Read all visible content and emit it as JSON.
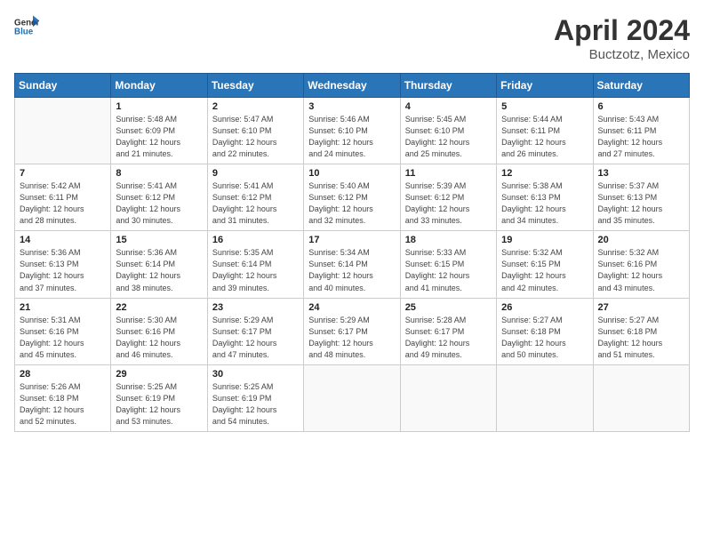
{
  "header": {
    "logo": {
      "general": "General",
      "blue": "Blue"
    },
    "title": "April 2024",
    "location": "Buctzotz, Mexico"
  },
  "calendar": {
    "weekdays": [
      "Sunday",
      "Monday",
      "Tuesday",
      "Wednesday",
      "Thursday",
      "Friday",
      "Saturday"
    ],
    "weeks": [
      [
        {
          "day": "",
          "info": ""
        },
        {
          "day": "1",
          "info": "Sunrise: 5:48 AM\nSunset: 6:09 PM\nDaylight: 12 hours\nand 21 minutes."
        },
        {
          "day": "2",
          "info": "Sunrise: 5:47 AM\nSunset: 6:10 PM\nDaylight: 12 hours\nand 22 minutes."
        },
        {
          "day": "3",
          "info": "Sunrise: 5:46 AM\nSunset: 6:10 PM\nDaylight: 12 hours\nand 24 minutes."
        },
        {
          "day": "4",
          "info": "Sunrise: 5:45 AM\nSunset: 6:10 PM\nDaylight: 12 hours\nand 25 minutes."
        },
        {
          "day": "5",
          "info": "Sunrise: 5:44 AM\nSunset: 6:11 PM\nDaylight: 12 hours\nand 26 minutes."
        },
        {
          "day": "6",
          "info": "Sunrise: 5:43 AM\nSunset: 6:11 PM\nDaylight: 12 hours\nand 27 minutes."
        }
      ],
      [
        {
          "day": "7",
          "info": "Sunrise: 5:42 AM\nSunset: 6:11 PM\nDaylight: 12 hours\nand 28 minutes."
        },
        {
          "day": "8",
          "info": "Sunrise: 5:41 AM\nSunset: 6:12 PM\nDaylight: 12 hours\nand 30 minutes."
        },
        {
          "day": "9",
          "info": "Sunrise: 5:41 AM\nSunset: 6:12 PM\nDaylight: 12 hours\nand 31 minutes."
        },
        {
          "day": "10",
          "info": "Sunrise: 5:40 AM\nSunset: 6:12 PM\nDaylight: 12 hours\nand 32 minutes."
        },
        {
          "day": "11",
          "info": "Sunrise: 5:39 AM\nSunset: 6:12 PM\nDaylight: 12 hours\nand 33 minutes."
        },
        {
          "day": "12",
          "info": "Sunrise: 5:38 AM\nSunset: 6:13 PM\nDaylight: 12 hours\nand 34 minutes."
        },
        {
          "day": "13",
          "info": "Sunrise: 5:37 AM\nSunset: 6:13 PM\nDaylight: 12 hours\nand 35 minutes."
        }
      ],
      [
        {
          "day": "14",
          "info": "Sunrise: 5:36 AM\nSunset: 6:13 PM\nDaylight: 12 hours\nand 37 minutes."
        },
        {
          "day": "15",
          "info": "Sunrise: 5:36 AM\nSunset: 6:14 PM\nDaylight: 12 hours\nand 38 minutes."
        },
        {
          "day": "16",
          "info": "Sunrise: 5:35 AM\nSunset: 6:14 PM\nDaylight: 12 hours\nand 39 minutes."
        },
        {
          "day": "17",
          "info": "Sunrise: 5:34 AM\nSunset: 6:14 PM\nDaylight: 12 hours\nand 40 minutes."
        },
        {
          "day": "18",
          "info": "Sunrise: 5:33 AM\nSunset: 6:15 PM\nDaylight: 12 hours\nand 41 minutes."
        },
        {
          "day": "19",
          "info": "Sunrise: 5:32 AM\nSunset: 6:15 PM\nDaylight: 12 hours\nand 42 minutes."
        },
        {
          "day": "20",
          "info": "Sunrise: 5:32 AM\nSunset: 6:16 PM\nDaylight: 12 hours\nand 43 minutes."
        }
      ],
      [
        {
          "day": "21",
          "info": "Sunrise: 5:31 AM\nSunset: 6:16 PM\nDaylight: 12 hours\nand 45 minutes."
        },
        {
          "day": "22",
          "info": "Sunrise: 5:30 AM\nSunset: 6:16 PM\nDaylight: 12 hours\nand 46 minutes."
        },
        {
          "day": "23",
          "info": "Sunrise: 5:29 AM\nSunset: 6:17 PM\nDaylight: 12 hours\nand 47 minutes."
        },
        {
          "day": "24",
          "info": "Sunrise: 5:29 AM\nSunset: 6:17 PM\nDaylight: 12 hours\nand 48 minutes."
        },
        {
          "day": "25",
          "info": "Sunrise: 5:28 AM\nSunset: 6:17 PM\nDaylight: 12 hours\nand 49 minutes."
        },
        {
          "day": "26",
          "info": "Sunrise: 5:27 AM\nSunset: 6:18 PM\nDaylight: 12 hours\nand 50 minutes."
        },
        {
          "day": "27",
          "info": "Sunrise: 5:27 AM\nSunset: 6:18 PM\nDaylight: 12 hours\nand 51 minutes."
        }
      ],
      [
        {
          "day": "28",
          "info": "Sunrise: 5:26 AM\nSunset: 6:18 PM\nDaylight: 12 hours\nand 52 minutes."
        },
        {
          "day": "29",
          "info": "Sunrise: 5:25 AM\nSunset: 6:19 PM\nDaylight: 12 hours\nand 53 minutes."
        },
        {
          "day": "30",
          "info": "Sunrise: 5:25 AM\nSunset: 6:19 PM\nDaylight: 12 hours\nand 54 minutes."
        },
        {
          "day": "",
          "info": ""
        },
        {
          "day": "",
          "info": ""
        },
        {
          "day": "",
          "info": ""
        },
        {
          "day": "",
          "info": ""
        }
      ]
    ]
  }
}
